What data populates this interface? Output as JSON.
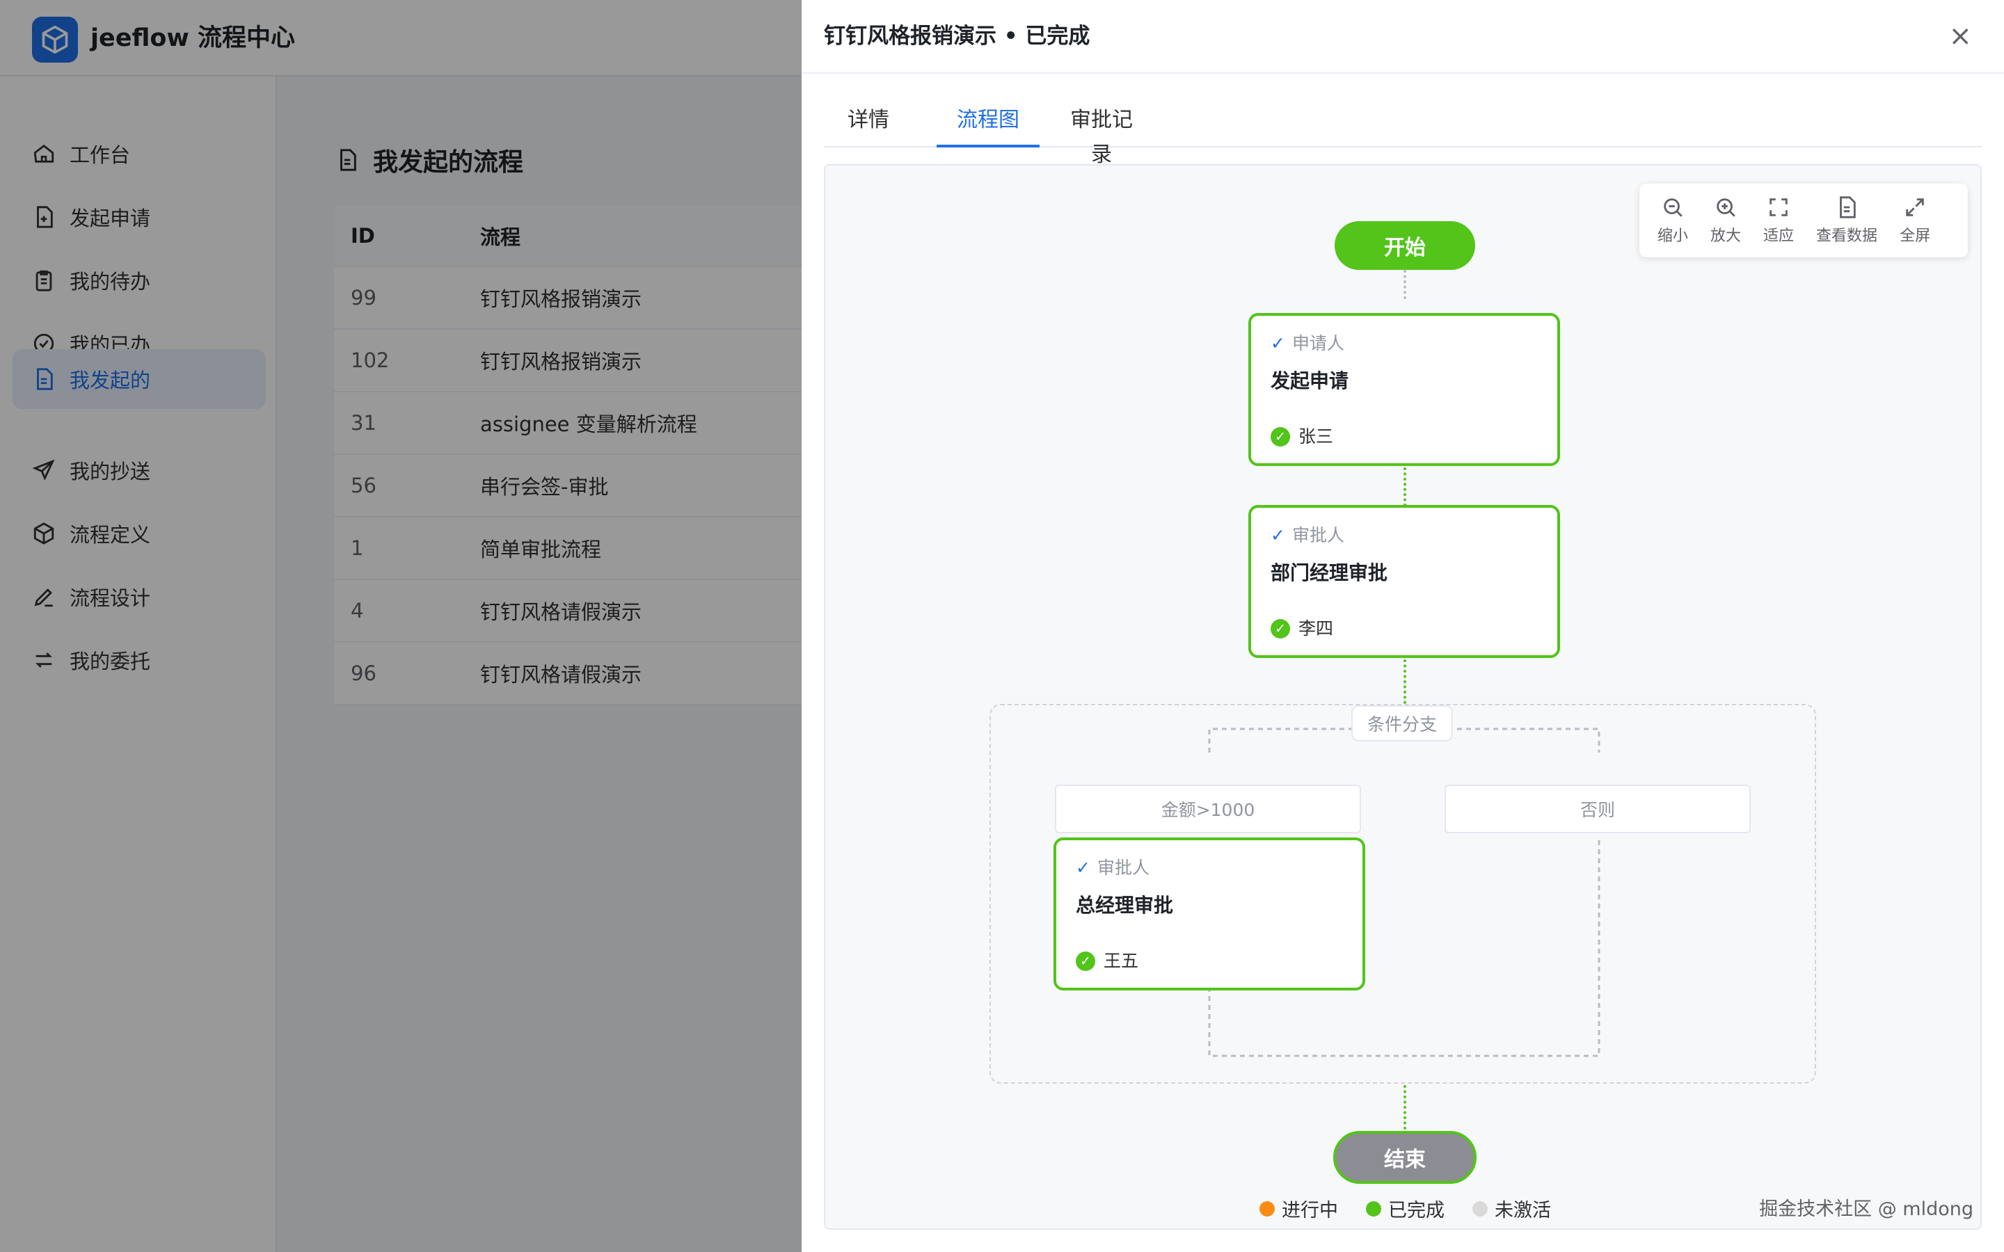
{
  "app": {
    "title": "jeeflow 流程中心"
  },
  "sidebar": {
    "items": [
      {
        "label": "工作台"
      },
      {
        "label": "发起申请"
      },
      {
        "label": "我的待办"
      },
      {
        "label": "我的已办"
      },
      {
        "label": "我发起的",
        "active": true
      },
      {
        "label": "我的抄送"
      },
      {
        "label": "流程定义"
      },
      {
        "label": "流程设计"
      },
      {
        "label": "我的委托"
      }
    ]
  },
  "main": {
    "title": "我发起的流程",
    "table": {
      "columns": [
        "ID",
        "流程"
      ],
      "rows": [
        {
          "id": "99",
          "name": "钉钉风格报销演示"
        },
        {
          "id": "102",
          "name": "钉钉风格报销演示"
        },
        {
          "id": "31",
          "name": "assignee 变量解析流程"
        },
        {
          "id": "56",
          "name": "串行会签-审批"
        },
        {
          "id": "1",
          "name": "简单审批流程"
        },
        {
          "id": "4",
          "name": "钉钉风格请假演示"
        },
        {
          "id": "96",
          "name": "钉钉风格请假演示"
        }
      ]
    }
  },
  "drawer": {
    "title": "钉钉风格报销演示 • 已完成",
    "close_label": "×",
    "tabs": [
      {
        "label": "详情"
      },
      {
        "label": "流程图",
        "active": true
      },
      {
        "label": "审批记录"
      }
    ],
    "toolbar": {
      "zoom_out": "缩小",
      "zoom_in": "放大",
      "fit": "适应",
      "view_data": "查看数据",
      "fullscreen": "全屏"
    },
    "flow": {
      "start": "开始",
      "end": "结束",
      "check_mark": "✓",
      "done_mark": "✓",
      "nodes": [
        {
          "role": "申请人",
          "name": "发起申请",
          "user": "张三"
        },
        {
          "role": "审批人",
          "name": "部门经理审批",
          "user": "李四"
        },
        {
          "role": "审批人",
          "name": "总经理审批",
          "user": "王五"
        }
      ],
      "branch_label": "条件分支",
      "conditions": [
        "金额>1000",
        "否则"
      ]
    },
    "legend": [
      {
        "label": "进行中",
        "color": "#fa8c16"
      },
      {
        "label": "已完成",
        "color": "#52c41a"
      },
      {
        "label": "未激活",
        "color": "#d9d9d9"
      }
    ],
    "watermark": "掘金技术社区 @ mldong"
  },
  "colors": {
    "accent": "#1f6fe5",
    "success": "#52c41a",
    "end_node": "#8c8c94"
  }
}
